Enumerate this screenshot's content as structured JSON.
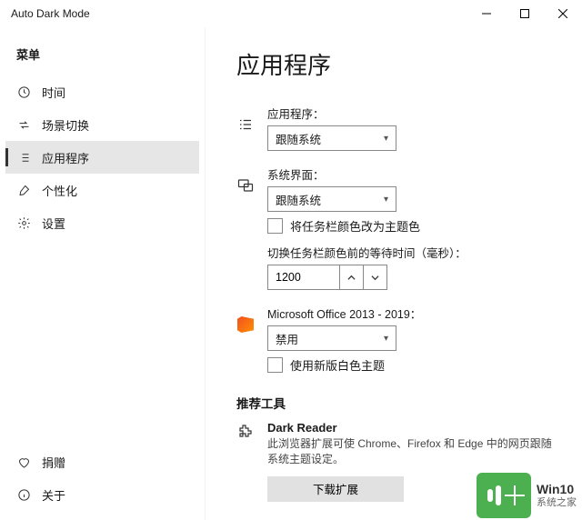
{
  "window": {
    "title": "Auto Dark Mode"
  },
  "sidebar": {
    "label": "菜单",
    "items": [
      {
        "label": "时间"
      },
      {
        "label": "场景切换"
      },
      {
        "label": "应用程序"
      },
      {
        "label": "个性化"
      },
      {
        "label": "设置"
      }
    ],
    "bottom": [
      {
        "label": "捐赠"
      },
      {
        "label": "关于"
      }
    ]
  },
  "main": {
    "heading": "应用程序",
    "apps": {
      "label": "应用程序：",
      "value": "跟随系统"
    },
    "system_ui": {
      "label": "系统界面：",
      "value": "跟随系统",
      "checkbox_label": "将任务栏颜色改为主题色",
      "delay_label": "切换任务栏颜色前的等待时间（毫秒）：",
      "delay_value": "1200"
    },
    "office": {
      "label": "Microsoft Office 2013 - 2019：",
      "value": "禁用",
      "checkbox_label": "使用新版白色主题"
    },
    "tools": {
      "heading": "推荐工具",
      "dark_reader": {
        "title": "Dark Reader",
        "desc": "此浏览器扩展可使 Chrome、Firefox 和 Edge 中的网页跟随系统主题设定。",
        "download": "下载扩展"
      }
    }
  },
  "watermark": {
    "line1": "Win10",
    "line2": "系统之家"
  }
}
